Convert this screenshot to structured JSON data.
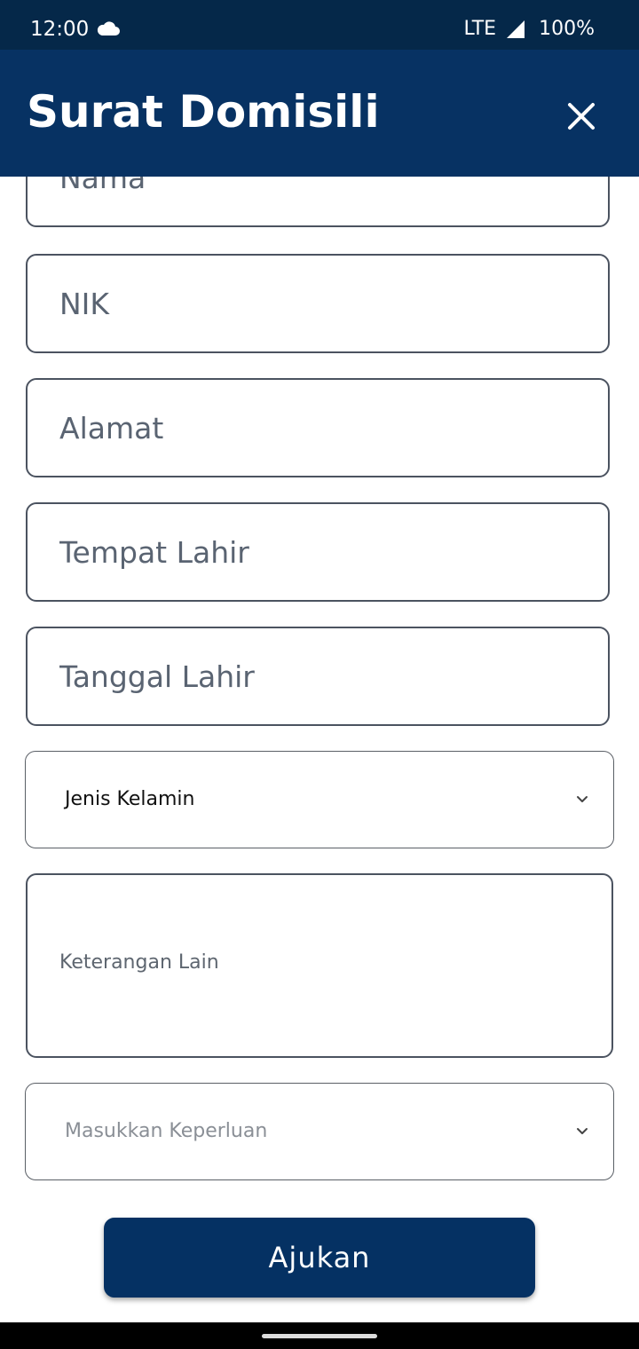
{
  "status_bar": {
    "time": "12:00",
    "network": "LTE",
    "battery": "100%"
  },
  "app_bar": {
    "title": "Surat Domisili"
  },
  "form": {
    "nama_placeholder": "Nama",
    "nik_placeholder": "NIK",
    "alamat_placeholder": "Alamat",
    "tempat_lahir_placeholder": "Tempat Lahir",
    "tanggal_lahir_placeholder": "Tanggal Lahir",
    "jenis_kelamin_value": "Jenis Kelamin",
    "keterangan_placeholder": "Keterangan Lain",
    "keperluan_placeholder": "Masukkan Keperluan",
    "submit_label": "Ajukan"
  },
  "colors": {
    "status_bar_bg": "#052849",
    "app_bar_bg": "#073263",
    "button_bg": "#053163",
    "field_border": "#4b5360"
  },
  "icons": [
    "cloud-icon",
    "signal-icon",
    "close-icon",
    "chevron-down-icon"
  ]
}
